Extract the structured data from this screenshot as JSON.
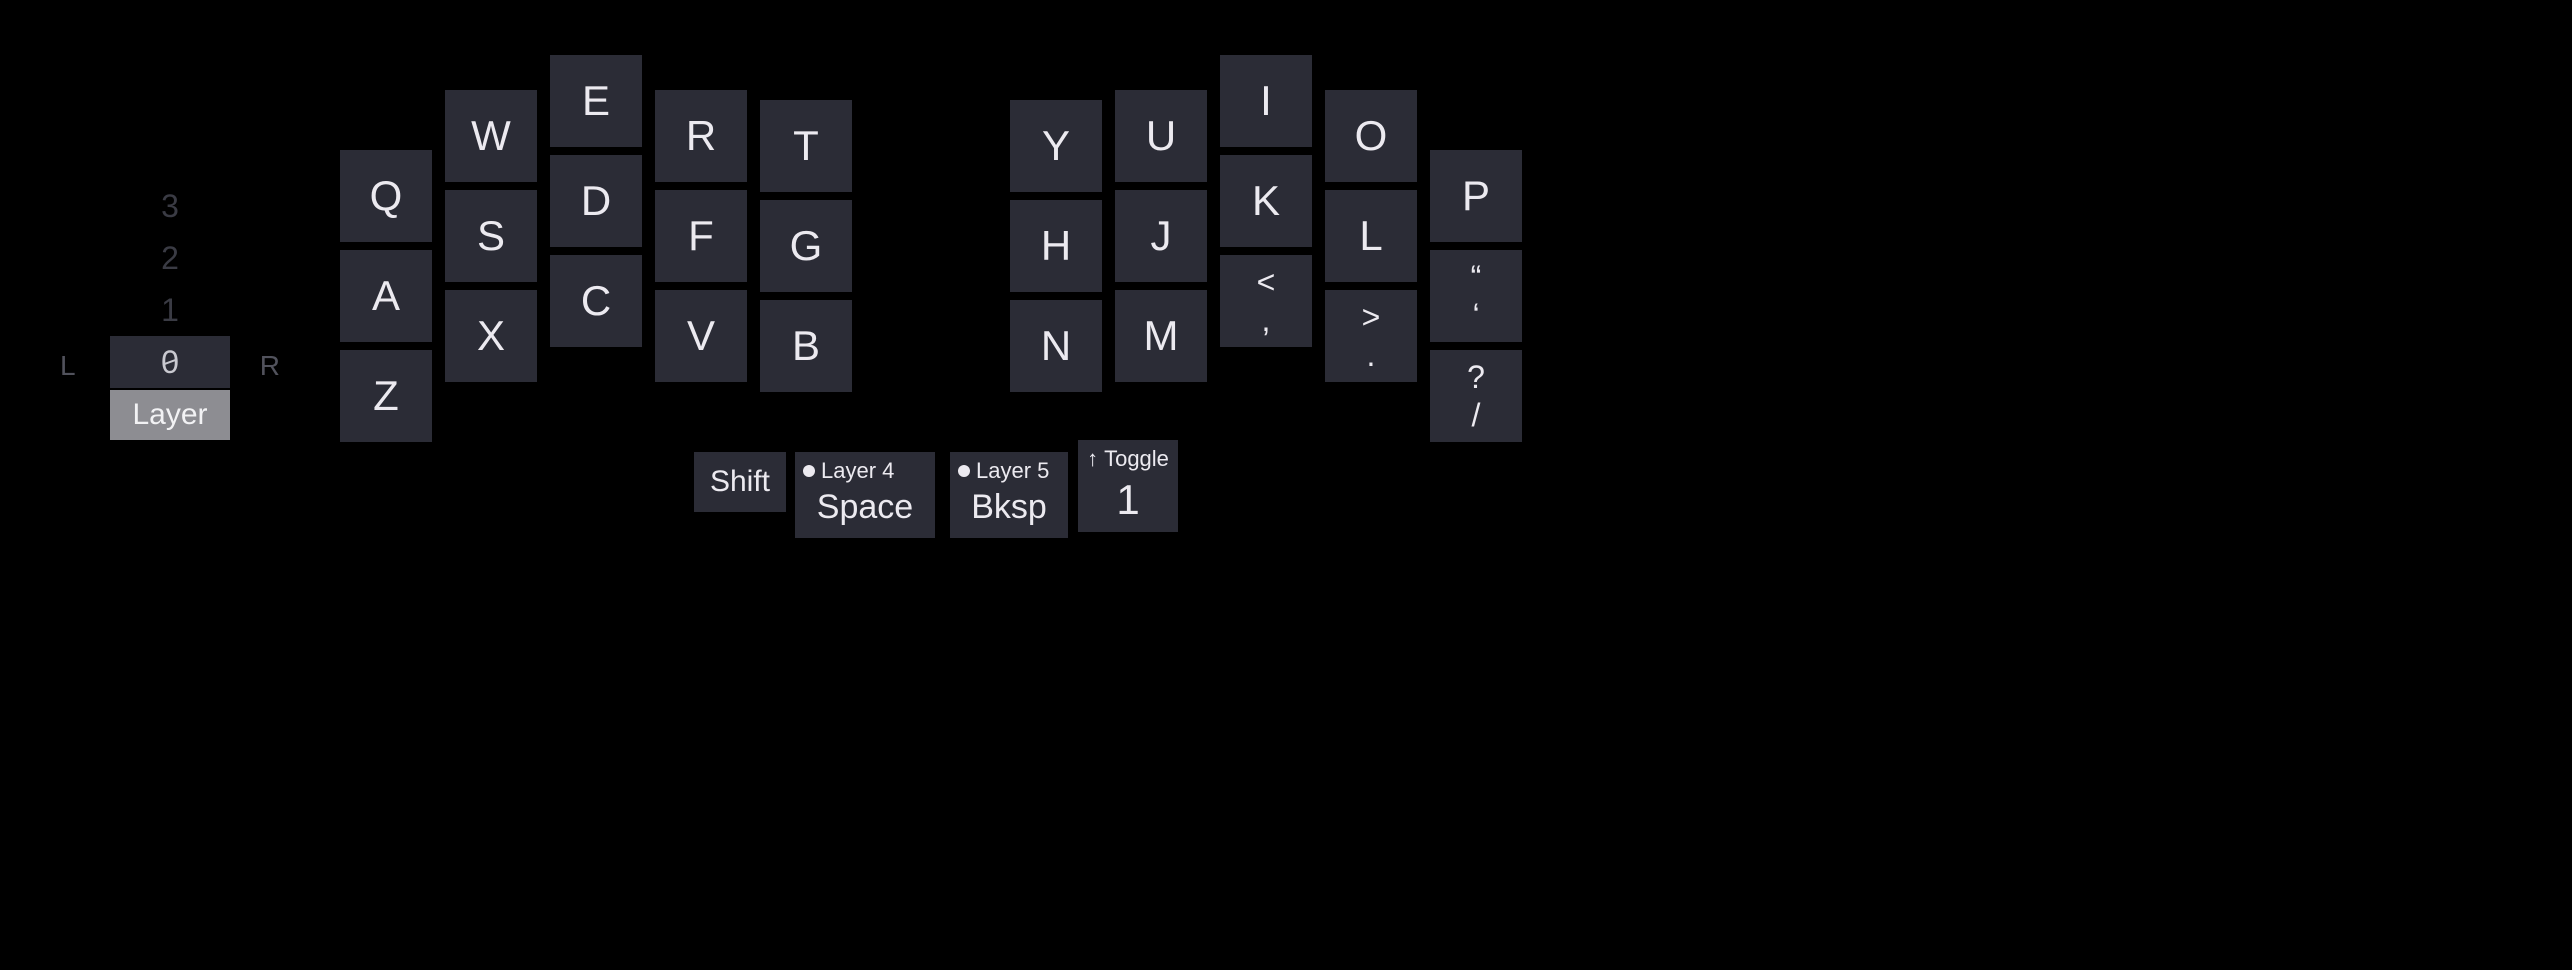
{
  "layerSelector": {
    "numbers": [
      "3",
      "2",
      "1",
      "0"
    ],
    "activeIndex": 3,
    "label": "Layer",
    "left": "L",
    "right": "R"
  },
  "leftHand": {
    "col0": [
      "Q",
      "A",
      "Z"
    ],
    "col1": [
      "W",
      "S",
      "X"
    ],
    "col2": [
      "E",
      "D",
      "C"
    ],
    "col3": [
      "R",
      "F",
      "V"
    ],
    "col4": [
      "T",
      "G",
      "B"
    ]
  },
  "rightHand": {
    "col0": [
      "Y",
      "H",
      "N"
    ],
    "col1": [
      "U",
      "J",
      "M"
    ],
    "col2top": "I",
    "col2mid": "K",
    "col2bot": {
      "top": "<",
      "bottom": ","
    },
    "col3top": "O",
    "col3mid": "L",
    "col3bot": {
      "top": ">",
      "bottom": "."
    },
    "col4top": "P",
    "col4mid": {
      "top": "“",
      "bottom": "‘"
    },
    "col4bot": {
      "top": "?",
      "bottom": "/"
    }
  },
  "thumb": {
    "shift": "Shift",
    "space": {
      "top": "Layer 4",
      "main": "Space"
    },
    "bksp": {
      "top": "Layer 5",
      "main": "Bksp"
    },
    "toggle": {
      "top": "Toggle",
      "main": "1",
      "arrow": "↑"
    }
  }
}
